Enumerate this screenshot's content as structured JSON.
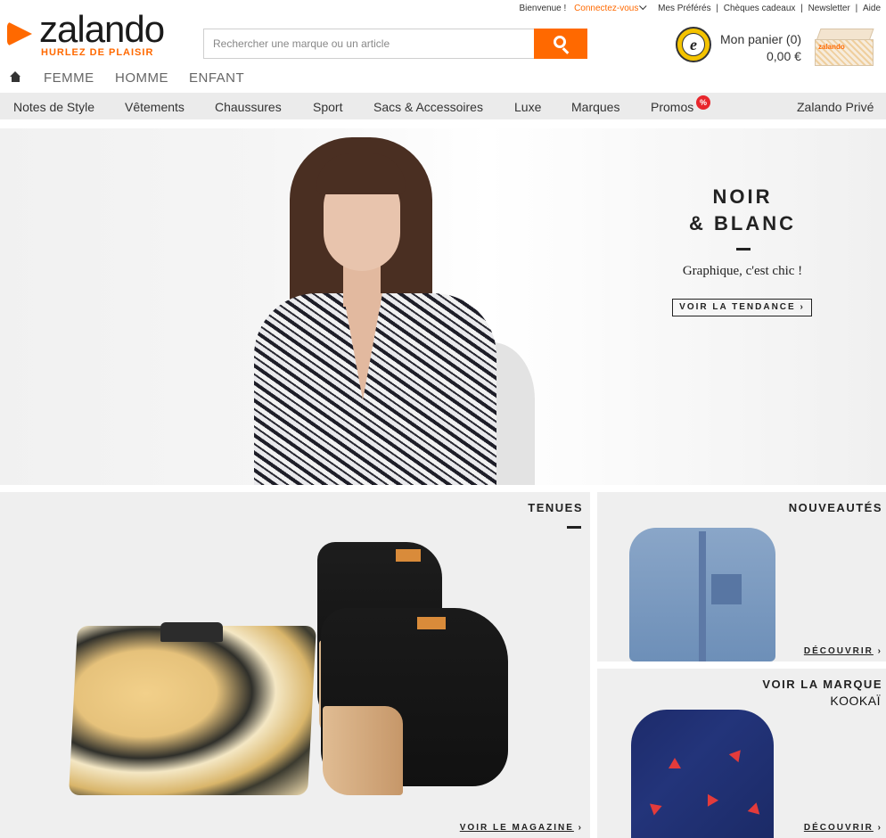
{
  "header": {
    "util": {
      "welcome": "Bienvenue !",
      "connect": "Connectez-vous",
      "favorites": "Mes Préférés",
      "gift": "Chèques cadeaux",
      "newsletter": "Newsletter",
      "help": "Aide",
      "sep": "|"
    },
    "logo": {
      "word": "zalando",
      "tagline": "HURLEZ DE PLAISIR"
    },
    "search": {
      "placeholder": "Rechercher une marque ou un article",
      "icon": "search-icon"
    },
    "trust_badge": {
      "letter": "e"
    },
    "cart": {
      "label": "Mon panier (0)",
      "total": "0,00 €",
      "box_brand": "zalando"
    }
  },
  "gender_tabs": [
    "FEMME",
    "HOMME",
    "ENFANT"
  ],
  "categories": [
    "Notes de Style",
    "Vêtements",
    "Chaussures",
    "Sport",
    "Sacs & Accessoires",
    "Luxe",
    "Marques",
    "Promos",
    "Zalando Privé"
  ],
  "promo_badge": "%",
  "hero": {
    "title_line1": "NOIR",
    "title_line2": "& BLANC",
    "subtitle": "Graphique, c'est chic !",
    "cta": "VOIR LA TENDANCE ›"
  },
  "tenues": {
    "title": "TENUES",
    "link": "VOIR LE MAGAZINE",
    "arrow": "›"
  },
  "nouveautes": {
    "title": "NOUVEAUTÉS",
    "link": "DÉCOUVRIR",
    "arrow": "›"
  },
  "marque": {
    "title": "VOIR LA MARQUE",
    "brand": "KOOKAÏ",
    "link": "DÉCOUVRIR",
    "arrow": "›"
  },
  "colors": {
    "accent": "#ff6900",
    "category_bar": "#ebebeb",
    "panel_bg": "#efefef",
    "promo": "#e8262c"
  }
}
